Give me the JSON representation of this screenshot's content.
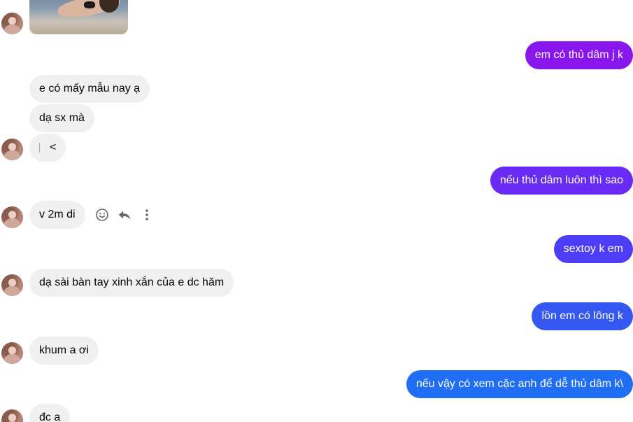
{
  "messages": {
    "out1": "em có thủ dâm j k",
    "in1": "e có mấy mẫu nay ạ",
    "in2": "dạ sx mà",
    "in3": "<",
    "out2": "nếu thủ dâm luôn thì sao",
    "in4": "v 2m di",
    "out3": "sextoy k em",
    "in5": "dạ sài bàn tay xinh xắn của e dc hăm",
    "out4": "lồn em có lông k",
    "in6": "khum a ơi",
    "out5": "nếu vậy có xem cặc anh để dễ thủ dâm k\\",
    "in7": "đc a"
  },
  "icons": {
    "avatar": "avatar-photo",
    "react": "smiley-icon",
    "reply": "reply-icon",
    "more": "more-vertical-icon"
  },
  "colors": {
    "incoming_bg": "#f0f0f0",
    "out1": "#8a16ee",
    "out2": "#6a2cf5",
    "out3": "#4d3df6",
    "out4": "#3557f2",
    "out5": "#1f6ef5"
  }
}
